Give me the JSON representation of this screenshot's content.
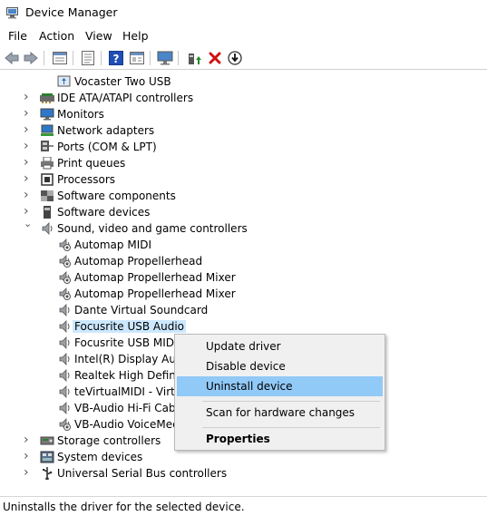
{
  "window": {
    "title": "Device Manager"
  },
  "menu": [
    "File",
    "Action",
    "View",
    "Help"
  ],
  "toolbar": {
    "buttons": [
      "back-icon",
      "forward-icon",
      "properties-list-icon",
      "properties-icon",
      "help-icon",
      "view-icon",
      "monitor-icon",
      "update-driver-icon",
      "uninstall-x-icon",
      "download-icon"
    ],
    "colors": {
      "help": "#1f4fb4",
      "uninstall": "#d01010",
      "update": "#2a8a2a"
    }
  },
  "tree": {
    "items": [
      {
        "label": "Vocaster Two USB",
        "icon": "usb-device-icon",
        "level": 2
      },
      {
        "label": "IDE ATA/ATAPI controllers",
        "icon": "ide-controller-icon",
        "level": 1,
        "expander": "collapsed"
      },
      {
        "label": "Monitors",
        "icon": "monitor-icon",
        "level": 1,
        "expander": "collapsed"
      },
      {
        "label": "Network adapters",
        "icon": "network-adapter-icon",
        "level": 1,
        "expander": "collapsed"
      },
      {
        "label": "Ports (COM & LPT)",
        "icon": "port-icon",
        "level": 1,
        "expander": "collapsed"
      },
      {
        "label": "Print queues",
        "icon": "printer-icon",
        "level": 1,
        "expander": "collapsed"
      },
      {
        "label": "Processors",
        "icon": "processor-icon",
        "level": 1,
        "expander": "collapsed"
      },
      {
        "label": "Software components",
        "icon": "software-component-icon",
        "level": 1,
        "expander": "collapsed"
      },
      {
        "label": "Software devices",
        "icon": "software-device-icon",
        "level": 1,
        "expander": "collapsed"
      },
      {
        "label": "Sound, video and game controllers",
        "icon": "speaker-icon",
        "level": 1,
        "expander": "expanded"
      },
      {
        "label": "Automap MIDI",
        "icon": "speaker-warning-icon",
        "level": 2
      },
      {
        "label": "Automap Propellerhead",
        "icon": "speaker-warning-icon",
        "level": 2
      },
      {
        "label": "Automap Propellerhead Mixer",
        "icon": "speaker-warning-icon",
        "level": 2
      },
      {
        "label": "Automap Propellerhead Mixer",
        "icon": "speaker-warning-icon",
        "level": 2
      },
      {
        "label": "Dante Virtual Soundcard",
        "icon": "speaker-icon",
        "level": 2
      },
      {
        "label": "Focusrite USB Audio",
        "icon": "speaker-icon",
        "level": 2,
        "selected": true
      },
      {
        "label": "Focusrite USB MIDI",
        "icon": "speaker-icon",
        "level": 2
      },
      {
        "label": "Intel(R) Display Audio",
        "icon": "speaker-icon",
        "level": 2
      },
      {
        "label": "Realtek High Definition Audio",
        "icon": "speaker-icon",
        "level": 2
      },
      {
        "label": "teVirtualMIDI - Virtual MIDI Driver",
        "icon": "speaker-icon",
        "level": 2
      },
      {
        "label": "VB-Audio Hi-Fi Cable",
        "icon": "speaker-icon",
        "level": 2
      },
      {
        "label": "VB-Audio VoiceMeeter VAIO",
        "icon": "speaker-warning-icon",
        "level": 2
      },
      {
        "label": "Storage controllers",
        "icon": "storage-controller-icon",
        "level": 1,
        "expander": "collapsed"
      },
      {
        "label": "System devices",
        "icon": "system-device-icon",
        "level": 1,
        "expander": "collapsed"
      },
      {
        "label": "Universal Serial Bus controllers",
        "icon": "usb-icon",
        "level": 1,
        "expander": "collapsed"
      }
    ]
  },
  "context_menu": {
    "items": [
      {
        "label": "Update driver"
      },
      {
        "label": "Disable device"
      },
      {
        "label": "Uninstall device",
        "highlighted": true
      },
      {
        "label": "Scan for hardware changes"
      },
      {
        "label": "Properties",
        "bold": true
      }
    ]
  },
  "status": {
    "text": "Uninstalls the driver for the selected device."
  }
}
